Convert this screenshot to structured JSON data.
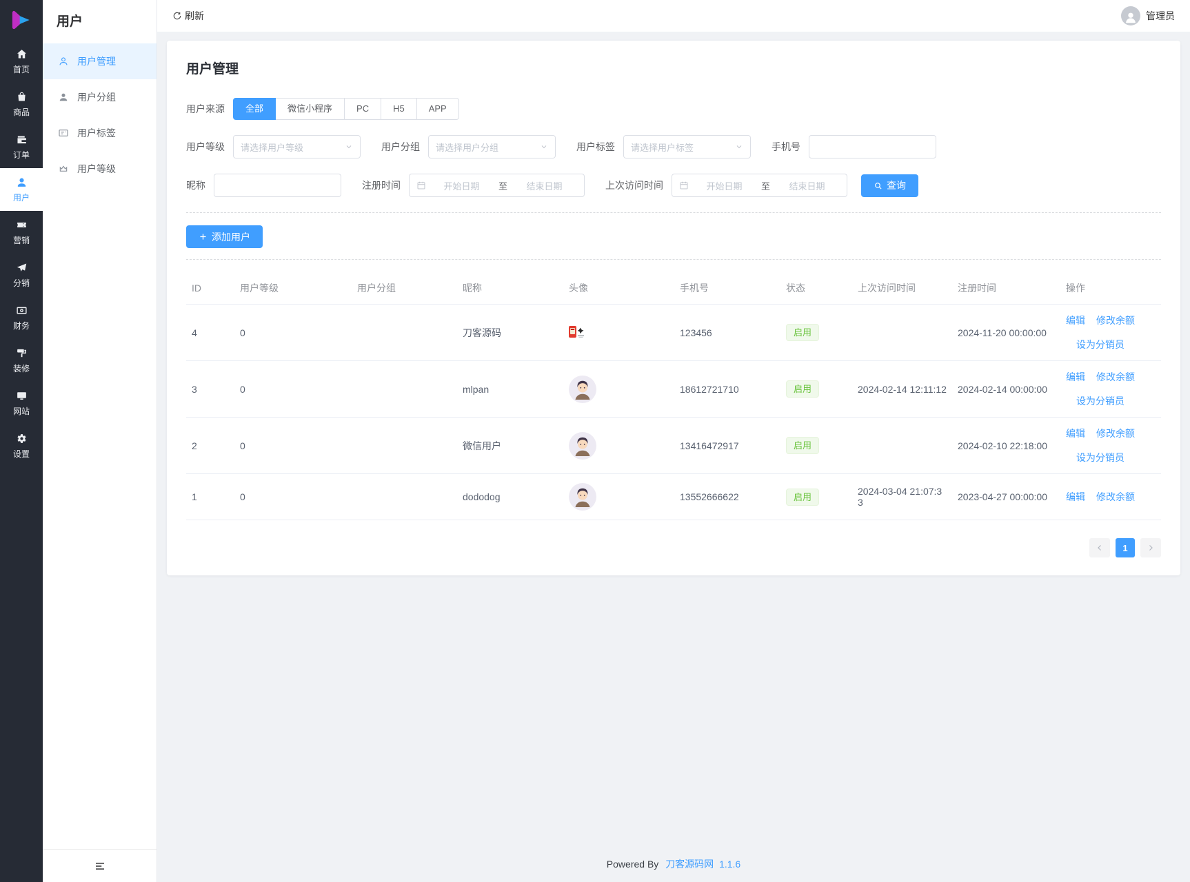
{
  "app": {
    "primary_nav": [
      {
        "label": "首页",
        "icon": "home",
        "active": false
      },
      {
        "label": "商品",
        "icon": "goods",
        "active": false
      },
      {
        "label": "订单",
        "icon": "orders",
        "active": false
      },
      {
        "label": "用户",
        "icon": "users",
        "active": true
      },
      {
        "label": "营销",
        "icon": "marketing",
        "active": false
      },
      {
        "label": "分销",
        "icon": "distribution",
        "active": false
      },
      {
        "label": "财务",
        "icon": "finance",
        "active": false
      },
      {
        "label": "装修",
        "icon": "decorate",
        "active": false
      },
      {
        "label": "网站",
        "icon": "website",
        "active": false
      },
      {
        "label": "设置",
        "icon": "settings",
        "active": false
      }
    ]
  },
  "sidebar": {
    "title": "用户",
    "items": [
      {
        "label": "用户管理",
        "icon": "user-manage",
        "active": true
      },
      {
        "label": "用户分组",
        "icon": "user-group",
        "active": false
      },
      {
        "label": "用户标签",
        "icon": "user-tag",
        "active": false
      },
      {
        "label": "用户等级",
        "icon": "user-level",
        "active": false
      }
    ]
  },
  "topbar": {
    "refresh_label": "刷新",
    "admin_label": "管理员"
  },
  "page": {
    "title": "用户管理"
  },
  "filters": {
    "source": {
      "label": "用户来源",
      "options": [
        "全部",
        "微信小程序",
        "PC",
        "H5",
        "APP"
      ],
      "selected": "全部"
    },
    "level": {
      "label": "用户等级",
      "placeholder": "请选择用户等级"
    },
    "group": {
      "label": "用户分组",
      "placeholder": "请选择用户分组"
    },
    "tag": {
      "label": "用户标签",
      "placeholder": "请选择用户标签"
    },
    "phone": {
      "label": "手机号",
      "value": ""
    },
    "nickname": {
      "label": "昵称",
      "value": ""
    },
    "register_time": {
      "label": "注册时间",
      "start_placeholder": "开始日期",
      "separator": "至",
      "end_placeholder": "结束日期"
    },
    "last_visit_time": {
      "label": "上次访问时间",
      "start_placeholder": "开始日期",
      "separator": "至",
      "end_placeholder": "结束日期"
    },
    "search_label": "查询"
  },
  "actions": {
    "add_user_label": "添加用户"
  },
  "table": {
    "columns": [
      "ID",
      "用户等级",
      "用户分组",
      "昵称",
      "头像",
      "手机号",
      "状态",
      "上次访问时间",
      "注册时间",
      "操作"
    ],
    "rows": [
      {
        "id": "4",
        "level": "0",
        "group": "",
        "nickname": "刀客源码",
        "avatar": "logo",
        "phone": "123456",
        "status": "启用",
        "last_visit": "",
        "register_time": "2024-11-20 00:00:00",
        "ops1": [
          "编辑",
          "修改余额"
        ],
        "ops2": [
          "设为分销员"
        ]
      },
      {
        "id": "3",
        "level": "0",
        "group": "",
        "nickname": "mlpan",
        "avatar": "boy",
        "phone": "18612721710",
        "status": "启用",
        "last_visit": "2024-02-14 12:11:12",
        "register_time": "2024-02-14 00:00:00",
        "ops1": [
          "编辑",
          "修改余额"
        ],
        "ops2": [
          "设为分销员"
        ]
      },
      {
        "id": "2",
        "level": "0",
        "group": "",
        "nickname": "微信用户",
        "avatar": "boy",
        "phone": "13416472917",
        "status": "启用",
        "last_visit": "",
        "register_time": "2024-02-10 22:18:00",
        "ops1": [
          "编辑",
          "修改余额"
        ],
        "ops2": [
          "设为分销员"
        ]
      },
      {
        "id": "1",
        "level": "0",
        "group": "",
        "nickname": "dododog",
        "avatar": "boy",
        "phone": "13552666622",
        "status": "启用",
        "last_visit": "2024-03-04 21:07:33",
        "register_time": "2023-04-27 00:00:00",
        "ops1": [
          "编辑",
          "修改余额"
        ],
        "ops2": []
      }
    ]
  },
  "pagination": {
    "pages": [
      "1"
    ],
    "active": "1"
  },
  "footer": {
    "powered_by": "Powered By",
    "brand": "刀客源码网",
    "version": "1.1.6"
  },
  "colors": {
    "accent": "#409eff",
    "success_text": "#67c23a",
    "success_bg": "#f0f9eb",
    "rail_dark": "#262b35",
    "active_sub_bg": "#e9f4ff"
  }
}
